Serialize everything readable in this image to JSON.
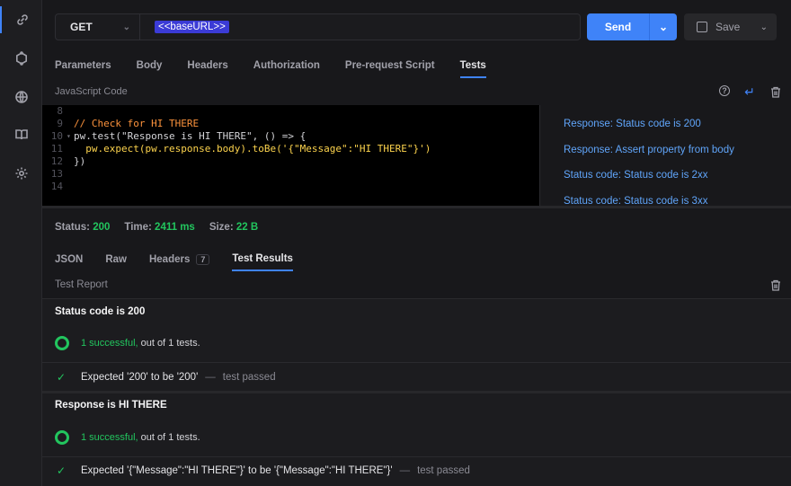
{
  "rail": {
    "icons": [
      "link-icon",
      "gear-bug-icon",
      "globe-icon",
      "book-icon",
      "settings-icon"
    ]
  },
  "request": {
    "method": "GET",
    "url_variable": "<<baseURL>>",
    "send_label": "Send",
    "save_label": "Save",
    "tabs": [
      {
        "label": "Parameters"
      },
      {
        "label": "Body"
      },
      {
        "label": "Headers"
      },
      {
        "label": "Authorization"
      },
      {
        "label": "Pre-request Script"
      },
      {
        "label": "Tests"
      }
    ],
    "active_tab": "Tests",
    "code_label": "JavaScript Code"
  },
  "editor": {
    "lines": [
      {
        "num": "8",
        "text": ""
      },
      {
        "num": "9",
        "text": "// Check for HI THERE"
      },
      {
        "num": "10",
        "text": "pw.test(\"Response is HI THERE\", () => {"
      },
      {
        "num": "11",
        "text": "  pw.expect(pw.response.body).toBe('{\"Message\":\"HI THERE\"}')"
      },
      {
        "num": "12",
        "text": "})"
      },
      {
        "num": "13",
        "text": ""
      },
      {
        "num": "14",
        "text": ""
      }
    ]
  },
  "snippets": [
    "Response: Status code is 200",
    "Response: Assert property from body",
    "Status code: Status code is 2xx",
    "Status code: Status code is 3xx"
  ],
  "response": {
    "status_label": "Status:",
    "status_value": "200",
    "time_label": "Time:",
    "time_value": "2411 ms",
    "size_label": "Size:",
    "size_value": "22 B",
    "tabs": [
      {
        "label": "JSON"
      },
      {
        "label": "Raw"
      },
      {
        "label": "Headers",
        "badge": "7"
      },
      {
        "label": "Test Results"
      }
    ],
    "active_tab": "Test Results",
    "report_label": "Test Report"
  },
  "results": [
    {
      "title": "Status code is 200",
      "successful": "1 successful,",
      "rest": "out of 1 tests.",
      "expectation": "Expected '200' to be '200'",
      "dash": "—",
      "status": "test passed"
    },
    {
      "title": "Response is HI THERE",
      "successful": "1 successful,",
      "rest": "out of 1 tests.",
      "expectation": "Expected '{\"Message\":\"HI THERE\"}' to be '{\"Message\":\"HI THERE\"}'",
      "dash": "—",
      "status": "test passed"
    }
  ],
  "colors": {
    "accent": "#3f83f8",
    "success": "#22c55e",
    "link": "#60a5fa",
    "comment": "#fb923c"
  }
}
